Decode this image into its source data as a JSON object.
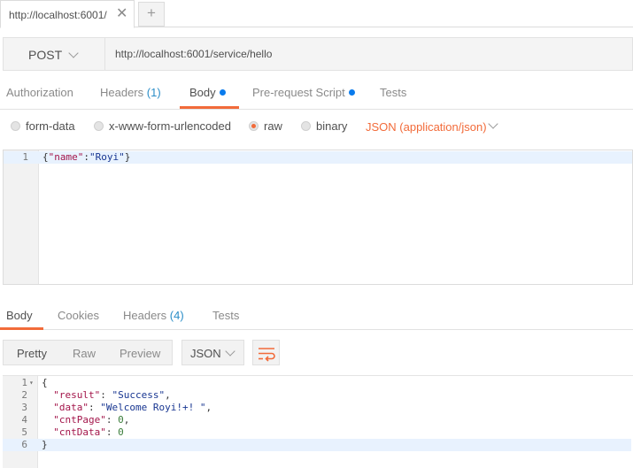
{
  "tabs": {
    "active_tab": "http://localhost:6001/",
    "close_symbol": "✕",
    "new_tab_symbol": "+"
  },
  "request": {
    "method": "POST",
    "url": "http://localhost:6001/service/hello"
  },
  "request_tabs": {
    "authorization": "Authorization",
    "headers": "Headers",
    "headers_count": "(1)",
    "body": "Body",
    "prerequest": "Pre-request Script",
    "tests": "Tests"
  },
  "body_options": {
    "form_data": "form-data",
    "urlencoded": "x-www-form-urlencoded",
    "raw": "raw",
    "binary": "binary",
    "content_type": "JSON (application/json)"
  },
  "request_body": {
    "line_number": "1",
    "punct_open": "{",
    "key": "\"name\"",
    "colon": ":",
    "value": "\"Royi\"",
    "punct_close": "}"
  },
  "response_tabs": {
    "body": "Body",
    "cookies": "Cookies",
    "headers": "Headers",
    "headers_count": "(4)",
    "tests": "Tests"
  },
  "response_view": {
    "pretty": "Pretty",
    "raw": "Raw",
    "preview": "Preview",
    "format": "JSON"
  },
  "response_body": {
    "line_numbers": [
      "1",
      "2",
      "3",
      "4",
      "5",
      "6"
    ],
    "open_brace": "{",
    "close_brace": "}",
    "result_key": "\"result\"",
    "result_value": "\"Success\"",
    "data_key": "\"data\"",
    "data_value": "\"Welcome Royi!+! \"",
    "cntpage_key": "\"cntPage\"",
    "cntpage_value": "0",
    "cntdata_key": "\"cntData\"",
    "cntdata_value": "0",
    "sep_colon": ": ",
    "comma": ","
  },
  "colors": {
    "accent": "#f26b3a",
    "dot_blue": "#097bed",
    "count_blue": "#2b8ec8"
  }
}
